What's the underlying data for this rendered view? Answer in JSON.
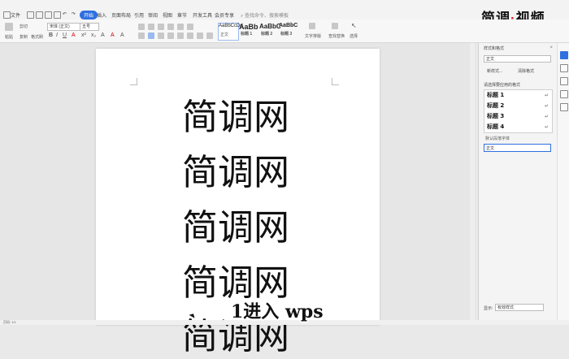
{
  "menu": {
    "file_label": "文件",
    "tabs": [
      "开始",
      "插入",
      "页面布局",
      "引用",
      "审阅",
      "视图",
      "章节",
      "开发工具",
      "会员专享"
    ],
    "active_tab": "开始",
    "search_placeholder": "查找命令、搜索模板"
  },
  "ribbon": {
    "paste": "粘贴",
    "cut": "剪切",
    "copy": "复制",
    "format_painter": "格式刷",
    "font_name": "宋体 (正文)",
    "font_size": "五号",
    "styles": [
      {
        "preview": "AaBbCcDd",
        "label": "正文"
      },
      {
        "preview": "AaBb",
        "label": "标题 1"
      },
      {
        "preview": "AaBbC",
        "label": "标题 2"
      },
      {
        "preview": "AaBbC",
        "label": "标题 3"
      }
    ],
    "text_tools": "文字排版",
    "find_replace": "查找替换",
    "select": "选择"
  },
  "logo": {
    "left": "简调",
    "dot": "·",
    "right": "视频"
  },
  "document": {
    "lines": [
      "简调网",
      "简调网",
      "简调网",
      "简调网",
      "简调网"
    ]
  },
  "panel": {
    "title": "样式和格式",
    "current_style": "正文",
    "new_style": "新样式...",
    "clear_format": "清除格式",
    "apply_header": "请选择要应用的格式",
    "styles": [
      "标题 1",
      "标题 2",
      "标题 3",
      "标题 4"
    ],
    "default_font": "默认段落字体",
    "selected": "正文",
    "show_label": "显示:",
    "show_value": "有效样式"
  },
  "status": {
    "page": "页码: 1/1"
  },
  "caption": "1进入 wps"
}
